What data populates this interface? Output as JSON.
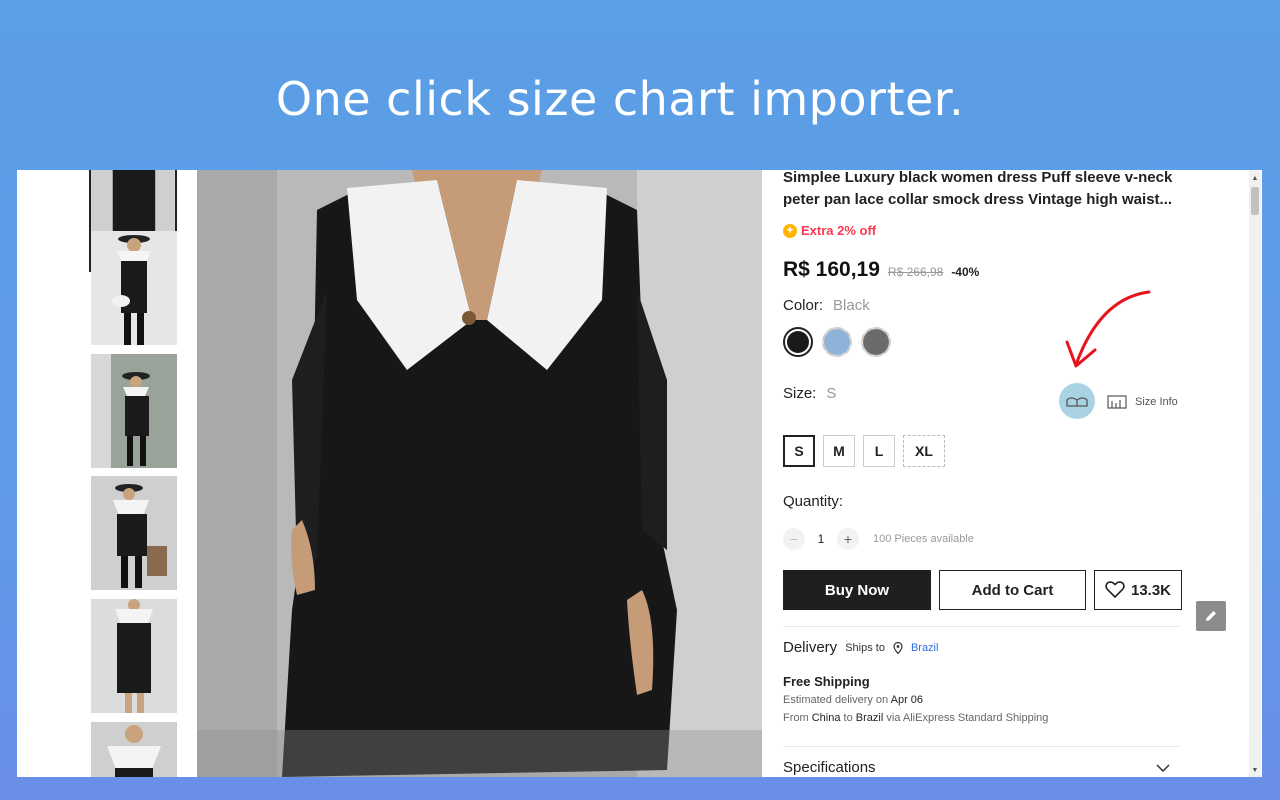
{
  "headline": "One click size chart importer.",
  "product": {
    "title": "Simplee Luxury black women dress Puff sleeve v-neck peter pan lace collar smock dress Vintage high waist...",
    "extra_off": "Extra 2% off",
    "price": "R$ 160,19",
    "old_price": "R$ 266,98",
    "discount": "-40%",
    "color_label": "Color:",
    "color_value": "Black",
    "size_label": "Size:",
    "size_value": "S",
    "size_info": "Size Info",
    "sizes": [
      "S",
      "M",
      "L",
      "XL"
    ],
    "quantity_label": "Quantity:",
    "quantity_minus": "−",
    "quantity_value": "1",
    "quantity_plus": "+",
    "available": "100 Pieces available",
    "buy_now": "Buy Now",
    "add_to_cart": "Add to Cart",
    "wishlist_count": "13.3K",
    "delivery_title": "Delivery",
    "ships_to": "Ships to",
    "ships_country": "Brazil",
    "free_shipping": "Free Shipping",
    "est_prefix": "Estimated delivery on",
    "est_date": "Apr 06",
    "from_word": "From",
    "from_country": "China",
    "to_word": "to",
    "to_country": "Brazil",
    "via_text": "via AliExpress Standard Shipping",
    "specifications": "Specifications"
  },
  "icons": {
    "coin": "coin-icon",
    "size_chart": "size-chart-import-icon",
    "size_info": "ruler-chart-icon",
    "heart": "heart-icon",
    "location": "location-pin-icon",
    "chevron": "chevron-down-icon",
    "edit": "pencil-icon"
  },
  "colors": {
    "accent_red": "#fd384f",
    "link_blue": "#2e6be6",
    "button_dark": "#1f1f1f",
    "size_chart_button": "#a9d3e3",
    "annotation_arrow": "#e8141c"
  }
}
